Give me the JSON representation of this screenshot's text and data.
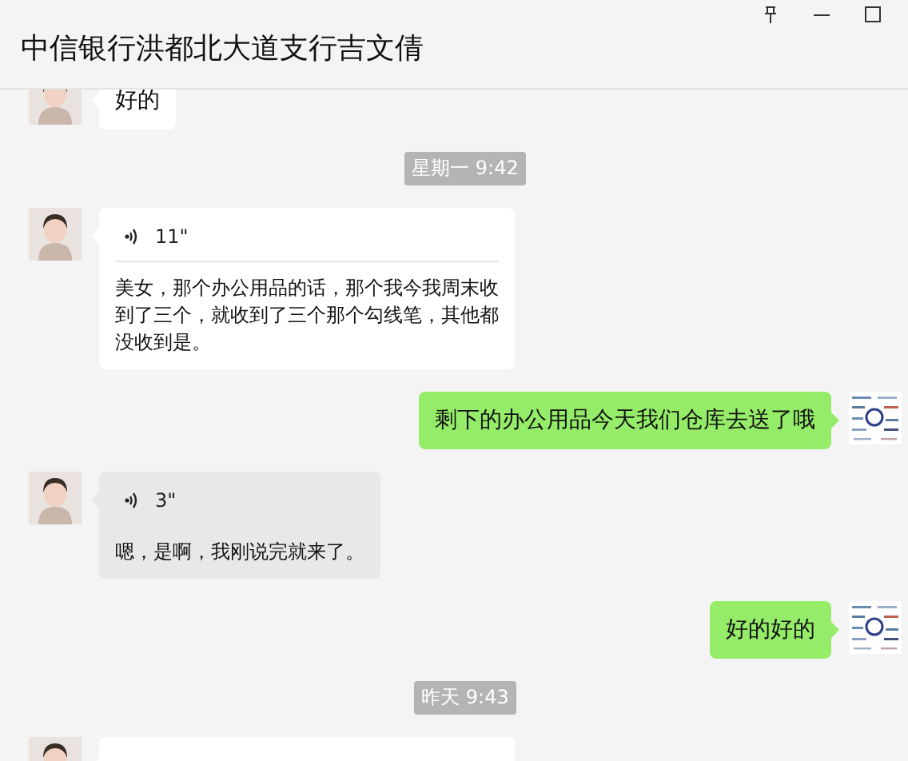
{
  "window": {
    "title": "中信银行洪都北大道支行吉文倩"
  },
  "messages": [
    {
      "kind": "text",
      "from_me": false,
      "text": "好的"
    },
    {
      "kind": "time",
      "text": "星期一 9:42"
    },
    {
      "kind": "voice",
      "from_me": false,
      "highlighted": false,
      "duration": "11\"",
      "transcript": "美女，那个办公用品的话，那个我今我周末收到了三个，就收到了三个那个勾线笔，其他都没收到是。"
    },
    {
      "kind": "text",
      "from_me": true,
      "text": "剩下的办公用品今天我们仓库去送了哦"
    },
    {
      "kind": "voice",
      "from_me": false,
      "highlighted": true,
      "duration": "3\"",
      "transcript": "嗯，是啊，我刚说完就来了。"
    },
    {
      "kind": "text",
      "from_me": true,
      "text": "好的好的"
    },
    {
      "kind": "time",
      "text": "昨天 9:43"
    },
    {
      "kind": "partial",
      "from_me": false
    }
  ]
}
